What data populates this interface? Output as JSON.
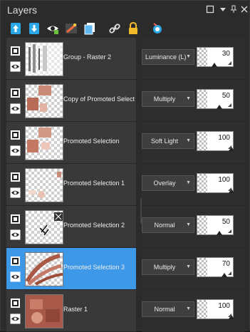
{
  "panel": {
    "title": "Layers"
  },
  "window_controls": [
    "restore-icon",
    "dropdown-icon",
    "pin-icon",
    "close-icon"
  ],
  "toolbar": [
    "new-raster-layer-icon",
    "new-vector-layer-icon",
    "new-mask-layer-icon",
    "new-adjustment-layer-icon",
    "duplicate-layer-icon",
    "link-icon",
    "lock-icon",
    "delete-layer-icon"
  ],
  "layers": [
    {
      "name": "Group - Raster 2",
      "blend": "Luminance (L)",
      "opacity": "30",
      "opacity_fraction": 0.3,
      "selected": false
    },
    {
      "name": "Copy of Promoted Selection",
      "blend": "Multiply",
      "opacity": "50",
      "opacity_fraction": 0.5,
      "selected": false
    },
    {
      "name": "Promoted Selection",
      "blend": "Soft Light",
      "opacity": "100",
      "opacity_fraction": 1.0,
      "selected": false
    },
    {
      "name": "Promoted Selection 1",
      "blend": "Overlay",
      "opacity": "100",
      "opacity_fraction": 1.0,
      "selected": false
    },
    {
      "name": "Promoted Selection 2",
      "blend": "Normal",
      "opacity": "50",
      "opacity_fraction": 0.5,
      "selected": false
    },
    {
      "name": "Promoted Selection 3",
      "blend": "Multiply",
      "opacity": "70",
      "opacity_fraction": 0.7,
      "selected": true
    },
    {
      "name": "Raster 1",
      "blend": "Normal",
      "opacity": "100",
      "opacity_fraction": 1.0,
      "selected": false
    }
  ],
  "colors": {
    "selected": "#3d98e8",
    "panel": "#2b2b2b",
    "row": "#393939"
  }
}
